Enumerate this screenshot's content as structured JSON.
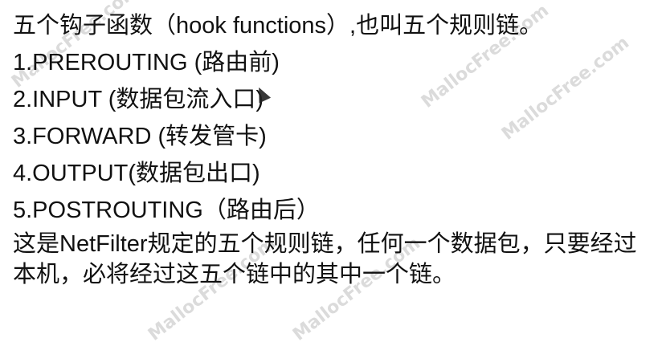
{
  "slide": {
    "lines": [
      "五个钩子函数（hook functions）,也叫五个规则链。",
      "1.PREROUTING (路由前)",
      "2.INPUT (数据包流入口)",
      "3.FORWARD (转发管卡)",
      "4.OUTPUT(数据包出口)",
      "5.POSTROUTING（路由后）"
    ],
    "paragraph": "这是NetFilter规定的五个规则链，任何一个数据包，只要经过本机，必将经过这五个链中的其中一个链。",
    "watermark_text": "MallocFree.com"
  }
}
